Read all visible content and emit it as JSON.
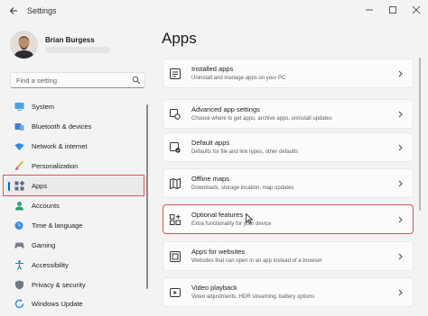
{
  "window": {
    "title": "Settings"
  },
  "user": {
    "name": "Brian Burgess"
  },
  "search": {
    "placeholder": "Find a setting"
  },
  "sidebar": {
    "items": [
      {
        "label": "System",
        "icon": "monitor-icon"
      },
      {
        "label": "Bluetooth & devices",
        "icon": "bluetooth-icon"
      },
      {
        "label": "Network & internet",
        "icon": "wifi-icon"
      },
      {
        "label": "Personalization",
        "icon": "brush-icon"
      },
      {
        "label": "Apps",
        "icon": "apps-icon",
        "selected": true
      },
      {
        "label": "Accounts",
        "icon": "person-icon"
      },
      {
        "label": "Time & language",
        "icon": "globe-clock-icon"
      },
      {
        "label": "Gaming",
        "icon": "gamepad-icon"
      },
      {
        "label": "Accessibility",
        "icon": "accessibility-icon"
      },
      {
        "label": "Privacy & security",
        "icon": "shield-icon"
      },
      {
        "label": "Windows Update",
        "icon": "update-icon"
      }
    ]
  },
  "main": {
    "title": "Apps",
    "cards": [
      {
        "title": "Installed apps",
        "subtitle": "Uninstall and manage apps on your PC",
        "icon": "installed-apps-icon"
      },
      {
        "title": "Advanced app settings",
        "subtitle": "Choose where to get apps, archive apps, uninstall updates",
        "icon": "advanced-apps-icon"
      },
      {
        "title": "Default apps",
        "subtitle": "Defaults for file and link types, other defaults",
        "icon": "default-apps-icon"
      },
      {
        "title": "Offline maps",
        "subtitle": "Downloads, storage location, map updates",
        "icon": "map-icon"
      },
      {
        "title": "Optional features",
        "subtitle": "Extra functionality for your device",
        "icon": "optional-features-icon",
        "highlighted": true
      },
      {
        "title": "Apps for websites",
        "subtitle": "Websites that can open in an app instead of a browser",
        "icon": "apps-for-websites-icon"
      },
      {
        "title": "Video playback",
        "subtitle": "Video adjustments, HDR streaming, battery options",
        "icon": "video-icon"
      }
    ]
  },
  "colors": {
    "accent": "#0067c0",
    "highlight_box": "#d9534f",
    "background": "#f3f3f3",
    "card": "#fbfbfb"
  }
}
